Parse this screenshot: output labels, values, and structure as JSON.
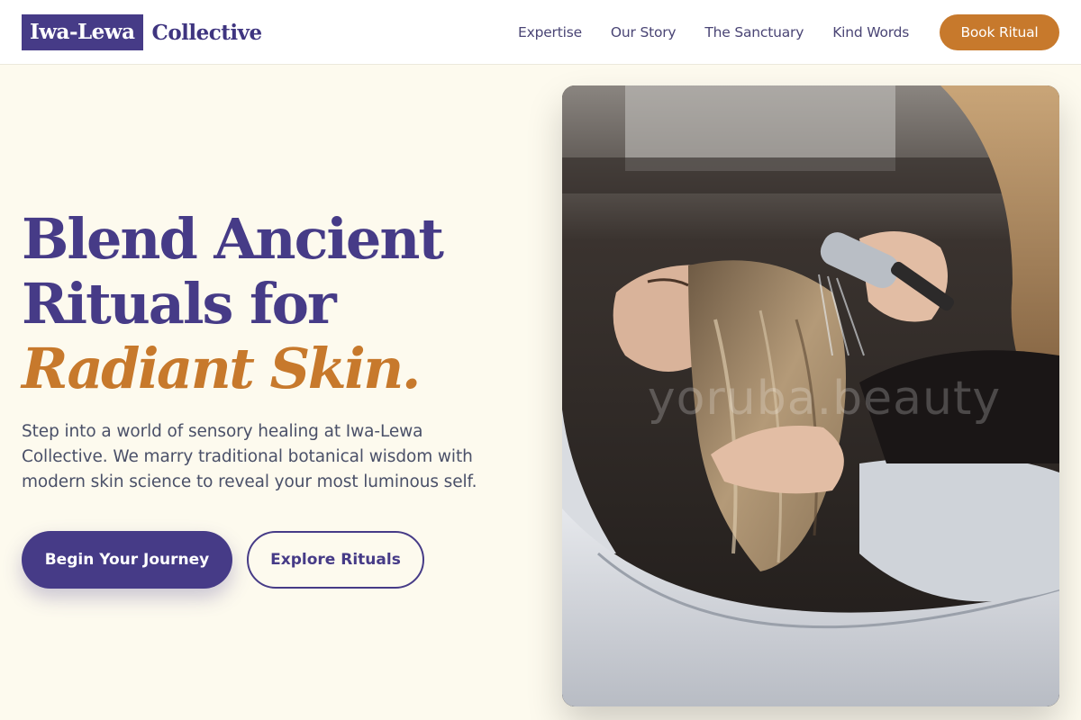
{
  "brand": {
    "name_box": "Iwa-Lewa",
    "name_rest": "Collective",
    "accent_color": "#463b87",
    "highlight_color": "#c7792c"
  },
  "nav": {
    "items": [
      {
        "label": "Expertise"
      },
      {
        "label": "Our Story"
      },
      {
        "label": "The Sanctuary"
      },
      {
        "label": "Kind Words"
      }
    ],
    "cta_label": "Book Ritual"
  },
  "hero": {
    "title_line1": "Blend Ancient",
    "title_line2": "Rituals for",
    "title_accent": "Radiant Skin.",
    "description": "Step into a world of sensory healing at Iwa-Lewa Collective. We marry traditional botanical wisdom with modern skin science to reveal your most luminous self.",
    "primary_button": "Begin Your Journey",
    "secondary_button": "Explore Rituals"
  },
  "image": {
    "watermark": "yoruba.beauty"
  }
}
